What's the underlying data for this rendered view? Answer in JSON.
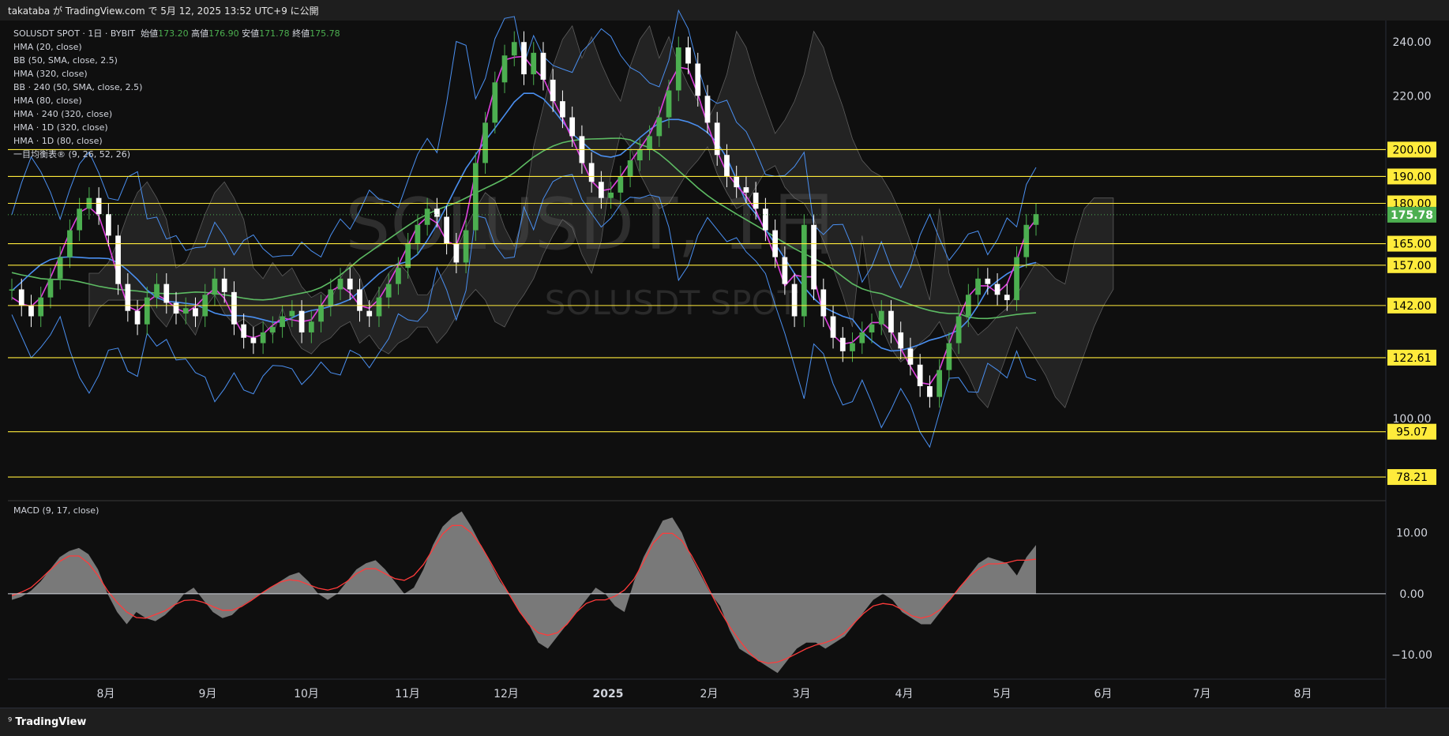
{
  "header": {
    "publish_text": "takataba が TradingView.com で 5月 12, 2025 13:52 UTC+9 に公開"
  },
  "legend": {
    "symbol": "SOLUSDT SPOT · 1日 · BYBIT",
    "open_label": "始値",
    "open": "173.20",
    "high_label": "高値",
    "high": "176.90",
    "low_label": "安値",
    "low": "171.78",
    "close_label": "終値",
    "close": "175.78",
    "indicators": [
      "HMA (20, close)",
      "BB (50, SMA, close, 2.5)",
      "HMA (320, close)",
      "BB · 240 (50, SMA, close, 2.5)",
      "HMA (80, close)",
      "HMA · 240 (320, close)",
      "HMA · 1D (320, close)",
      "HMA · 1D (80, close)",
      "一目均衡表® (9, 26, 52, 26)"
    ]
  },
  "watermark": {
    "main": "SOLUSDT, 1日",
    "sub": "SOLUSDT SPOT"
  },
  "macd_label": "MACD (9, 17, close)",
  "footer": {
    "brand": "TradingView"
  },
  "colors": {
    "up": "#4caf50",
    "down": "#ffffff",
    "hma20": "#e040e0",
    "hma80": "#4a8ff0",
    "hma320": "#5dbb63",
    "bb": "#4a8ff0",
    "hline": "#ffeb3b",
    "macd_signal": "#ff3b3b",
    "macd_hist": "#8c8c8c",
    "last_price_bg": "#4caf50",
    "label_bg": "#ffeb3b"
  },
  "chart_data": {
    "type": "candlestick",
    "ylim": [
      70,
      248
    ],
    "price_axis_ticks": [
      "240.00",
      "220.00",
      "100.00"
    ],
    "horizontal_levels": [
      200.0,
      190.0,
      180.0,
      165.0,
      157.0,
      142.0,
      122.61,
      95.07,
      78.21
    ],
    "level_labels": [
      "200.00",
      "190.00",
      "180.00",
      "165.00",
      "157.00",
      "142.00",
      "122.61",
      "95.07",
      "78.21"
    ],
    "last_price": 175.78,
    "last_price_label": "175.78",
    "months": [
      "8月",
      "9月",
      "10月",
      "11月",
      "12月",
      "2025",
      "2月",
      "3月",
      "4月",
      "5月",
      "6月",
      "7月",
      "8月"
    ],
    "ohlc_closes": [
      148,
      142,
      138,
      145,
      152,
      160,
      170,
      178,
      182,
      176,
      168,
      150,
      140,
      135,
      145,
      150,
      143,
      139,
      141,
      138,
      146,
      152,
      147,
      135,
      130,
      128,
      132,
      134,
      138,
      140,
      132,
      136,
      142,
      148,
      152,
      148,
      140,
      138,
      145,
      150,
      156,
      165,
      172,
      178,
      175,
      165,
      158,
      170,
      195,
      210,
      225,
      235,
      240,
      228,
      236,
      226,
      218,
      212,
      205,
      195,
      188,
      182,
      184,
      190,
      196,
      200,
      205,
      212,
      222,
      238,
      232,
      220,
      210,
      198,
      190,
      186,
      184,
      178,
      170,
      160,
      150,
      138,
      172,
      148,
      138,
      130,
      125,
      128,
      132,
      135,
      140,
      132,
      126,
      120,
      112,
      108,
      118,
      128,
      138,
      146,
      152,
      150,
      146,
      144,
      160,
      172,
      176
    ],
    "macd": {
      "ylim": [
        -14,
        15
      ],
      "ticks": [
        "10.00",
        "0.00",
        "−10.00"
      ],
      "hist": [
        -1,
        -0.5,
        0.5,
        2,
        4,
        6,
        7,
        7.5,
        6.5,
        4,
        0,
        -3,
        -5,
        -3,
        -4,
        -4.5,
        -3.5,
        -2,
        0,
        1,
        -1,
        -3,
        -4,
        -3.5,
        -2,
        -1,
        0,
        1,
        2,
        3,
        3.5,
        2,
        0,
        -1,
        0,
        2,
        4,
        5,
        5.5,
        4,
        2,
        0,
        1,
        4,
        8,
        11,
        12.5,
        13.5,
        11,
        8,
        5,
        2,
        0,
        -3,
        -5,
        -8,
        -9,
        -7,
        -5,
        -3,
        -1,
        1,
        0,
        -2,
        -3,
        2,
        6,
        9,
        12,
        12.5,
        10,
        6,
        3,
        0,
        -2,
        -6,
        -9,
        -10,
        -11,
        -12,
        -13,
        -11,
        -9,
        -8,
        -8,
        -9,
        -8,
        -7,
        -5,
        -3,
        -1,
        0,
        -1,
        -3,
        -4,
        -5,
        -5,
        -3,
        -1,
        1,
        3,
        5,
        6,
        5.5,
        5,
        3,
        6,
        8
      ]
    }
  }
}
